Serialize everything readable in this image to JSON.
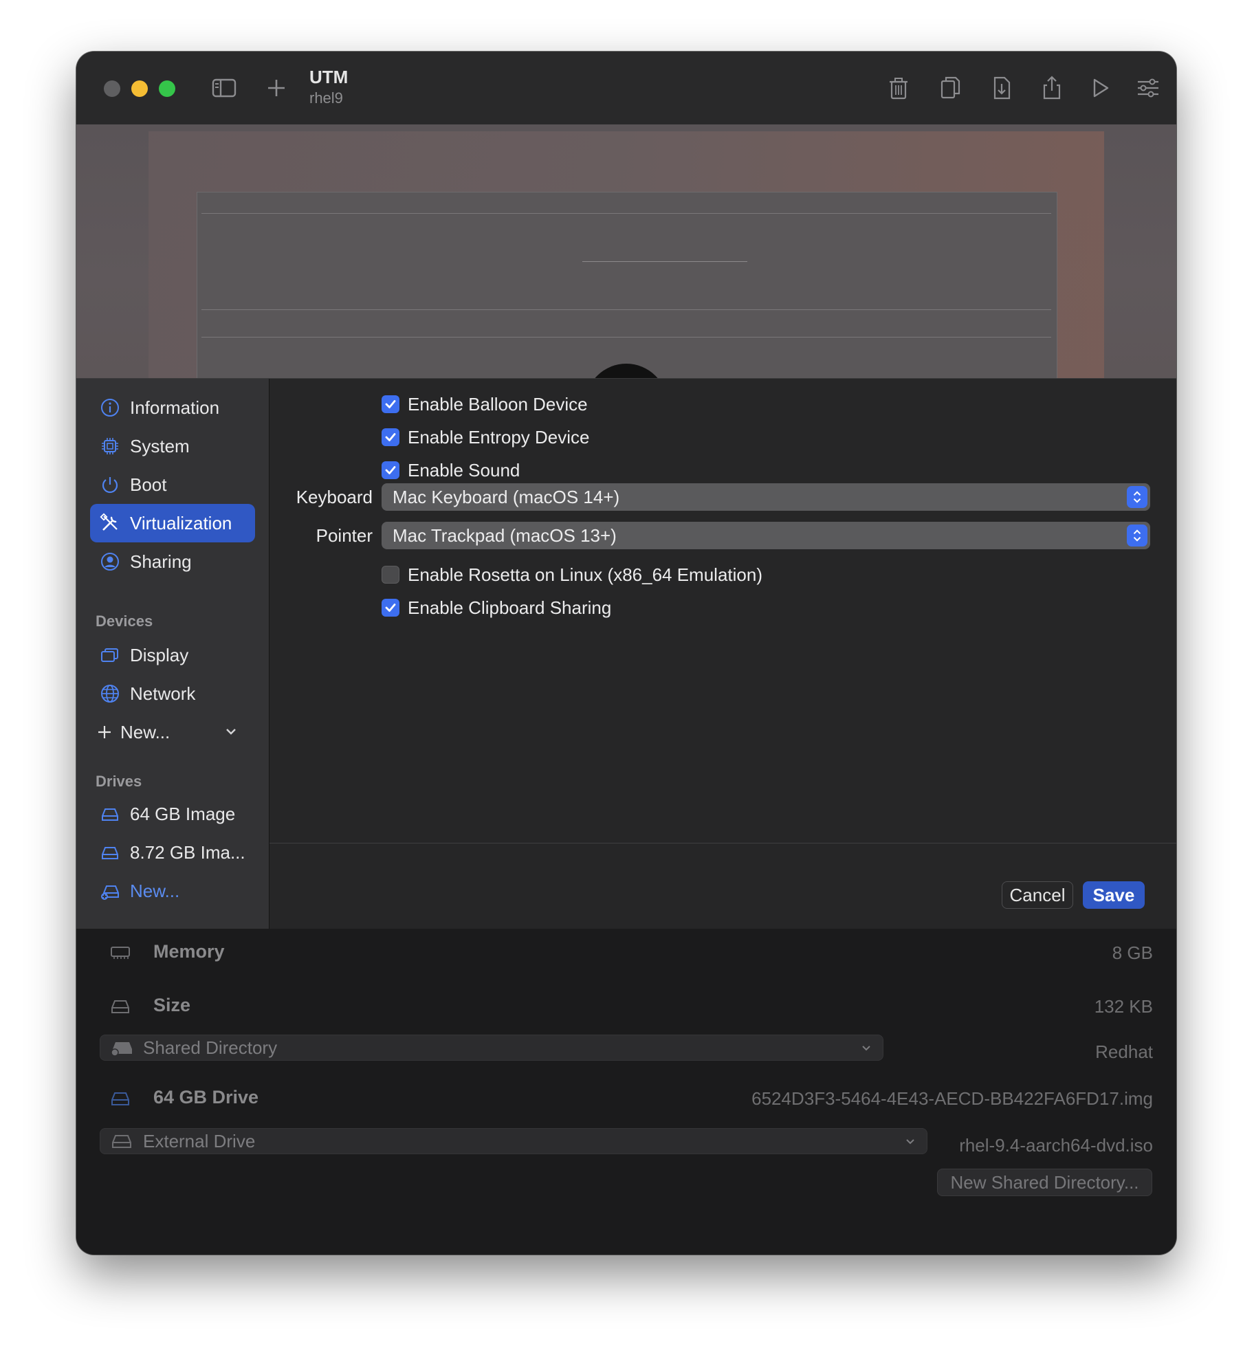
{
  "app": {
    "title": "UTM",
    "subtitle": "rhel9"
  },
  "toolbar": {
    "icons": [
      "sidebar-toggle-icon",
      "plus-icon",
      "trash-icon",
      "clone-icon",
      "download-icon",
      "share-icon",
      "play-icon",
      "settings-sliders-icon"
    ]
  },
  "sidebar": {
    "items": [
      {
        "label": "Information",
        "icon": "info-icon"
      },
      {
        "label": "System",
        "icon": "cpu-icon"
      },
      {
        "label": "Boot",
        "icon": "power-icon"
      },
      {
        "label": "Virtualization",
        "icon": "tools-icon",
        "selected": true
      },
      {
        "label": "Sharing",
        "icon": "person-circle-icon"
      }
    ],
    "devices_heading": "Devices",
    "devices": [
      {
        "label": "Display",
        "icon": "display-icon"
      },
      {
        "label": "Network",
        "icon": "globe-icon"
      },
      {
        "label": "New...",
        "icon": "plus-icon"
      }
    ],
    "drives_heading": "Drives",
    "drives": [
      {
        "label": "64 GB Image",
        "icon": "drive-icon"
      },
      {
        "label": "8.72 GB Ima...",
        "icon": "drive-icon"
      },
      {
        "label": "New...",
        "icon": "drive-add-icon"
      }
    ]
  },
  "virtualization": {
    "balloon": {
      "label": "Enable Balloon Device",
      "checked": true
    },
    "entropy": {
      "label": "Enable Entropy Device",
      "checked": true
    },
    "sound": {
      "label": "Enable Sound",
      "checked": true
    },
    "keyboard": {
      "label": "Keyboard",
      "value": "Mac Keyboard (macOS 14+)"
    },
    "pointer": {
      "label": "Pointer",
      "value": "Mac Trackpad (macOS 13+)"
    },
    "rosetta": {
      "label": "Enable Rosetta on Linux (x86_64 Emulation)",
      "checked": false
    },
    "clipboard": {
      "label": "Enable Clipboard Sharing",
      "checked": true
    }
  },
  "buttons": {
    "cancel": "Cancel",
    "save": "Save"
  },
  "details": {
    "memory": {
      "label": "Memory",
      "value": "8 GB"
    },
    "size": {
      "label": "Size",
      "value": "132 KB"
    },
    "shared_directory": {
      "label": "Shared Directory",
      "value": "Redhat"
    },
    "drive": {
      "label": "64 GB Drive",
      "value": "6524D3F3-5464-4E43-AECD-BB422FA6FD17.img"
    },
    "external_drive": {
      "label": "External Drive",
      "value": "rhel-9.4-aarch64-dvd.iso"
    },
    "new_shared_button": "New Shared Directory..."
  },
  "colors": {
    "accent": "#3058c4",
    "checkbox": "#3d6ef0",
    "traffic_close": "#5f5f61",
    "traffic_min": "#f5bd34",
    "traffic_max": "#35c54a"
  }
}
